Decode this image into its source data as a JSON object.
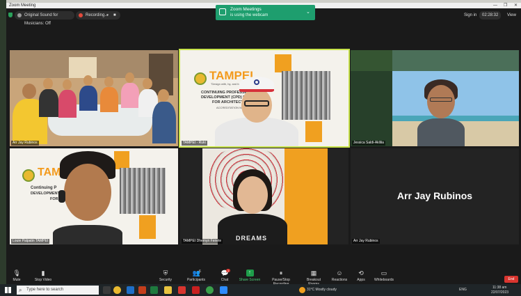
{
  "window": {
    "title": "Zoom Meeting",
    "minimize": "—",
    "maximize": "❐",
    "close": "✕"
  },
  "topbar": {
    "original_sound": "Original Sound for Musicians: Off",
    "recording": "Recording...",
    "pause": "⏸",
    "stop": "■",
    "sign_in": "Sign in",
    "timer": "02:28:32",
    "view": "View"
  },
  "notification": {
    "title": "Zoom Meetings",
    "text": "is using the webcam"
  },
  "participants": [
    {
      "name": "Arr Jay Rubinos"
    },
    {
      "name": "TAMPEI - Ruki"
    },
    {
      "name": "Jessica Saldi-Aklilia"
    },
    {
      "name": "Louie Palpatin TAMPEI"
    },
    {
      "name": "TAMPEI Dhemyn Fenete"
    },
    {
      "name": "Arr Jay Rubinos"
    }
  ],
  "name_tile": {
    "label": "Arr Jay Rubinos"
  },
  "slide": {
    "brand": "TAMPEI",
    "tagline": "\"Design with, by, and for the people\"",
    "heading_line1": "CONTINUING PROFESSIONAL",
    "heading_line2": "DEVELOPMENT (CPD) PROGRAM",
    "heading_line3": "FOR ARCHITECTS",
    "accreditation": "ACCREDITATION NO. ARC",
    "brand_short": "TAMP",
    "heading_short1": "Continuing P",
    "heading_short2": "DEVELOPMENT (C",
    "heading_short3": "FOR"
  },
  "shirt": {
    "text": "DREAMS"
  },
  "toolbar": {
    "mute": "Mute",
    "stop_video": "Stop Video",
    "security": "Security",
    "participants": "Participants",
    "participants_count": "6",
    "chat": "Chat",
    "chat_badge": "1",
    "share_screen": "Share Screen",
    "pause_recording": "Pause/Stop Recording",
    "breakout": "Breakout Rooms",
    "reactions": "Reactions",
    "apps": "Apps",
    "whiteboards": "Whiteboards",
    "end": "End"
  },
  "taskbar": {
    "search_placeholder": "Type here to search",
    "weather": "31°C  Mostly cloudy",
    "lang": "ENG",
    "time": "11:38 am",
    "date": "22/07/2023"
  }
}
